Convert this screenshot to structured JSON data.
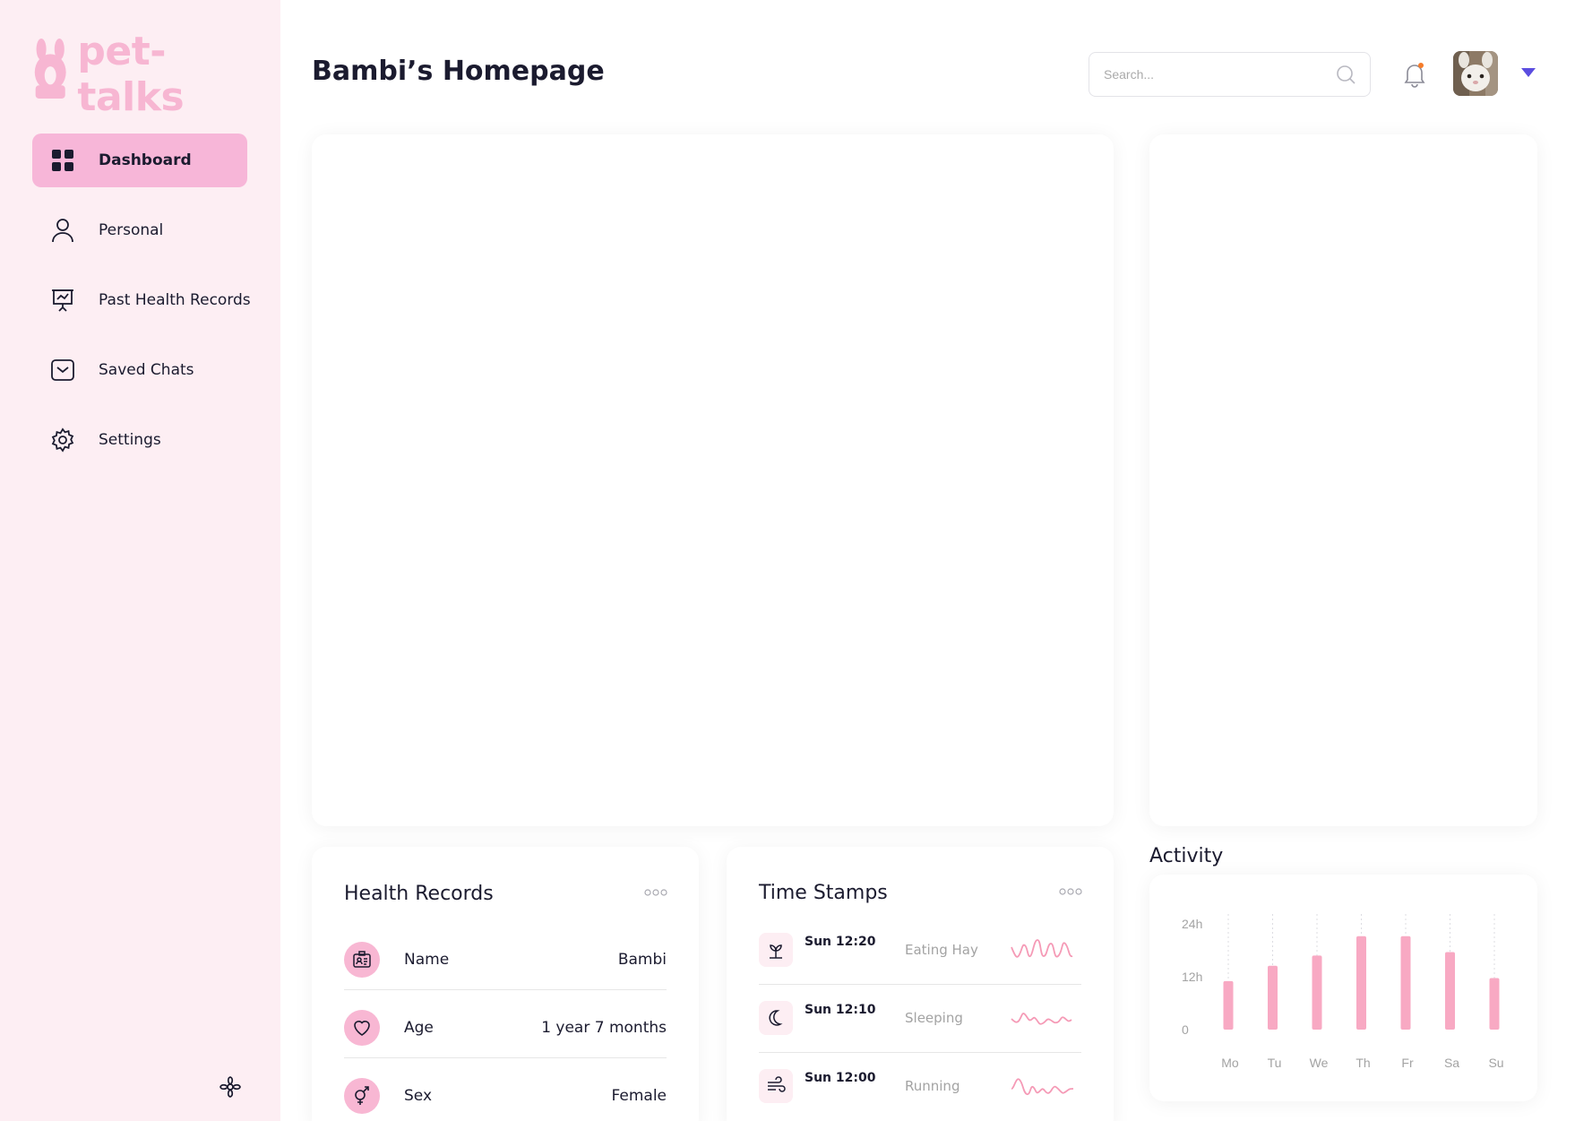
{
  "app": {
    "logo_text": "pet-talks",
    "brand_color": "#f7b6d2"
  },
  "sidebar": {
    "items": [
      {
        "label": "Dashboard",
        "icon": "grid-icon",
        "active": true
      },
      {
        "label": "Personal",
        "icon": "user-icon",
        "active": false
      },
      {
        "label": "Past Health Records",
        "icon": "presentation-chart-icon",
        "active": false
      },
      {
        "label": "Saved Chats",
        "icon": "mail-icon",
        "active": false
      },
      {
        "label": "Settings",
        "icon": "gear-icon",
        "active": false
      }
    ],
    "footer_icon": "flower-icon"
  },
  "header": {
    "title": "Bambi’s Homepage",
    "search_placeholder": "Search...",
    "notification_icon": "bell-icon",
    "notification_dot_color": "#f57c2a",
    "dropdown_color": "#5b4de0"
  },
  "health_records": {
    "title": "Health Records",
    "rows": [
      {
        "label": "Name",
        "value": "Bambi",
        "icon": "id-card-icon"
      },
      {
        "label": "Age",
        "value": "1 year 7 months",
        "icon": "heart-icon"
      },
      {
        "label": "Sex",
        "value": "Female",
        "icon": "gender-icon"
      }
    ]
  },
  "time_stamps": {
    "title": "Time Stamps",
    "rows": [
      {
        "time": "Sun 12:20",
        "activity": "Eating Hay",
        "icon": "sprout-icon"
      },
      {
        "time": "Sun 12:10",
        "activity": "Sleeping",
        "icon": "moon-icon"
      },
      {
        "time": "Sun 12:00",
        "activity": "Running",
        "icon": "wind-icon"
      }
    ]
  },
  "activity": {
    "title": "Activity"
  },
  "chart_data": {
    "type": "bar",
    "categories": [
      "Mo",
      "Tu",
      "We",
      "Th",
      "Fr",
      "Sa",
      "Su"
    ],
    "values": [
      11,
      14.5,
      16.8,
      21.2,
      21.2,
      17.6,
      11.7
    ],
    "yticks": [
      "0",
      "12h",
      "24h"
    ],
    "ylim": [
      0,
      24
    ],
    "bar_color": "#f8a9c3",
    "grid": "vertical dotted lines"
  }
}
